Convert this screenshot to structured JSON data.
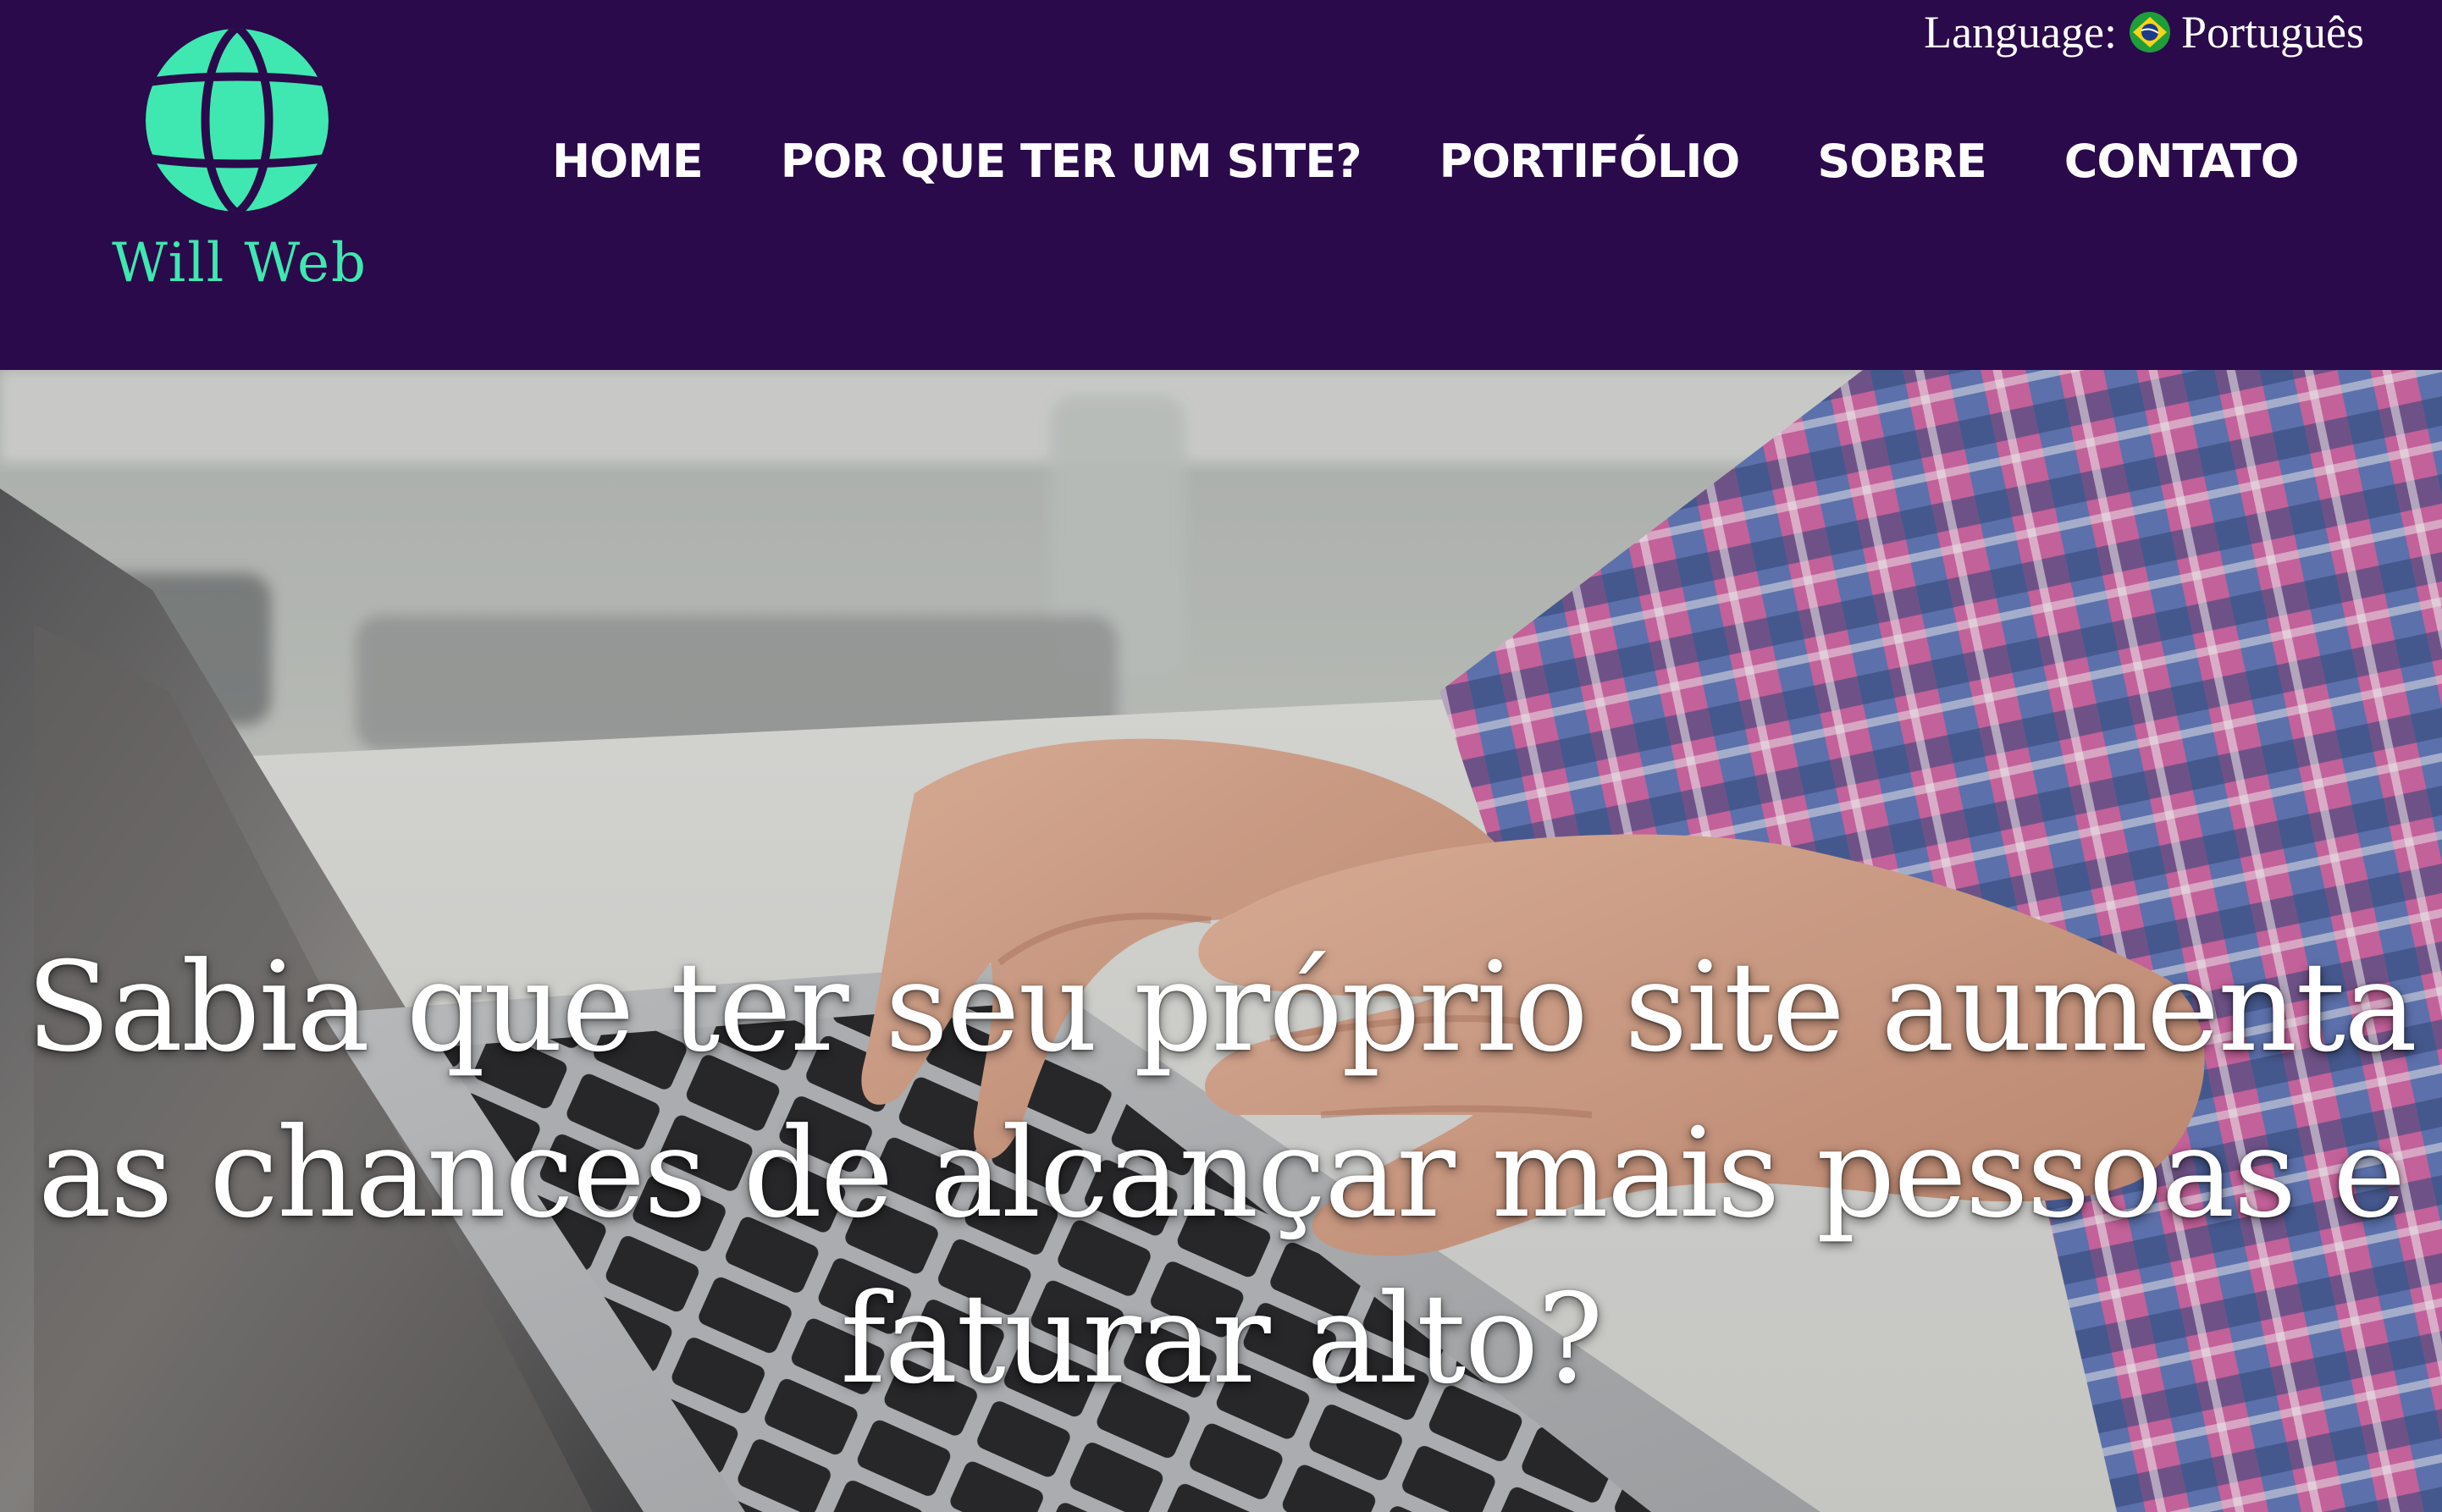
{
  "brand": {
    "name": "Will Web",
    "logo_icon": "globe-icon",
    "logo_color": "#3ee8b0"
  },
  "language": {
    "label": "Language:",
    "value": "Português",
    "flag_icon": "brazil-flag-icon"
  },
  "nav": {
    "items": [
      {
        "label": "HOME"
      },
      {
        "label": "POR QUE TER UM SITE?"
      },
      {
        "label": "PORTIFÓLIO"
      },
      {
        "label": "SOBRE"
      },
      {
        "label": "CONTATO"
      }
    ]
  },
  "hero": {
    "heading": "Sabia que ter seu próprio site aumenta as chances de alcançar mais pessoas e faturar alto?",
    "image": "hands-typing-on-laptop-photo"
  },
  "colors": {
    "header_bg": "#2a0a4a",
    "accent": "#3ee8b0",
    "nav_text": "#ffffff"
  }
}
